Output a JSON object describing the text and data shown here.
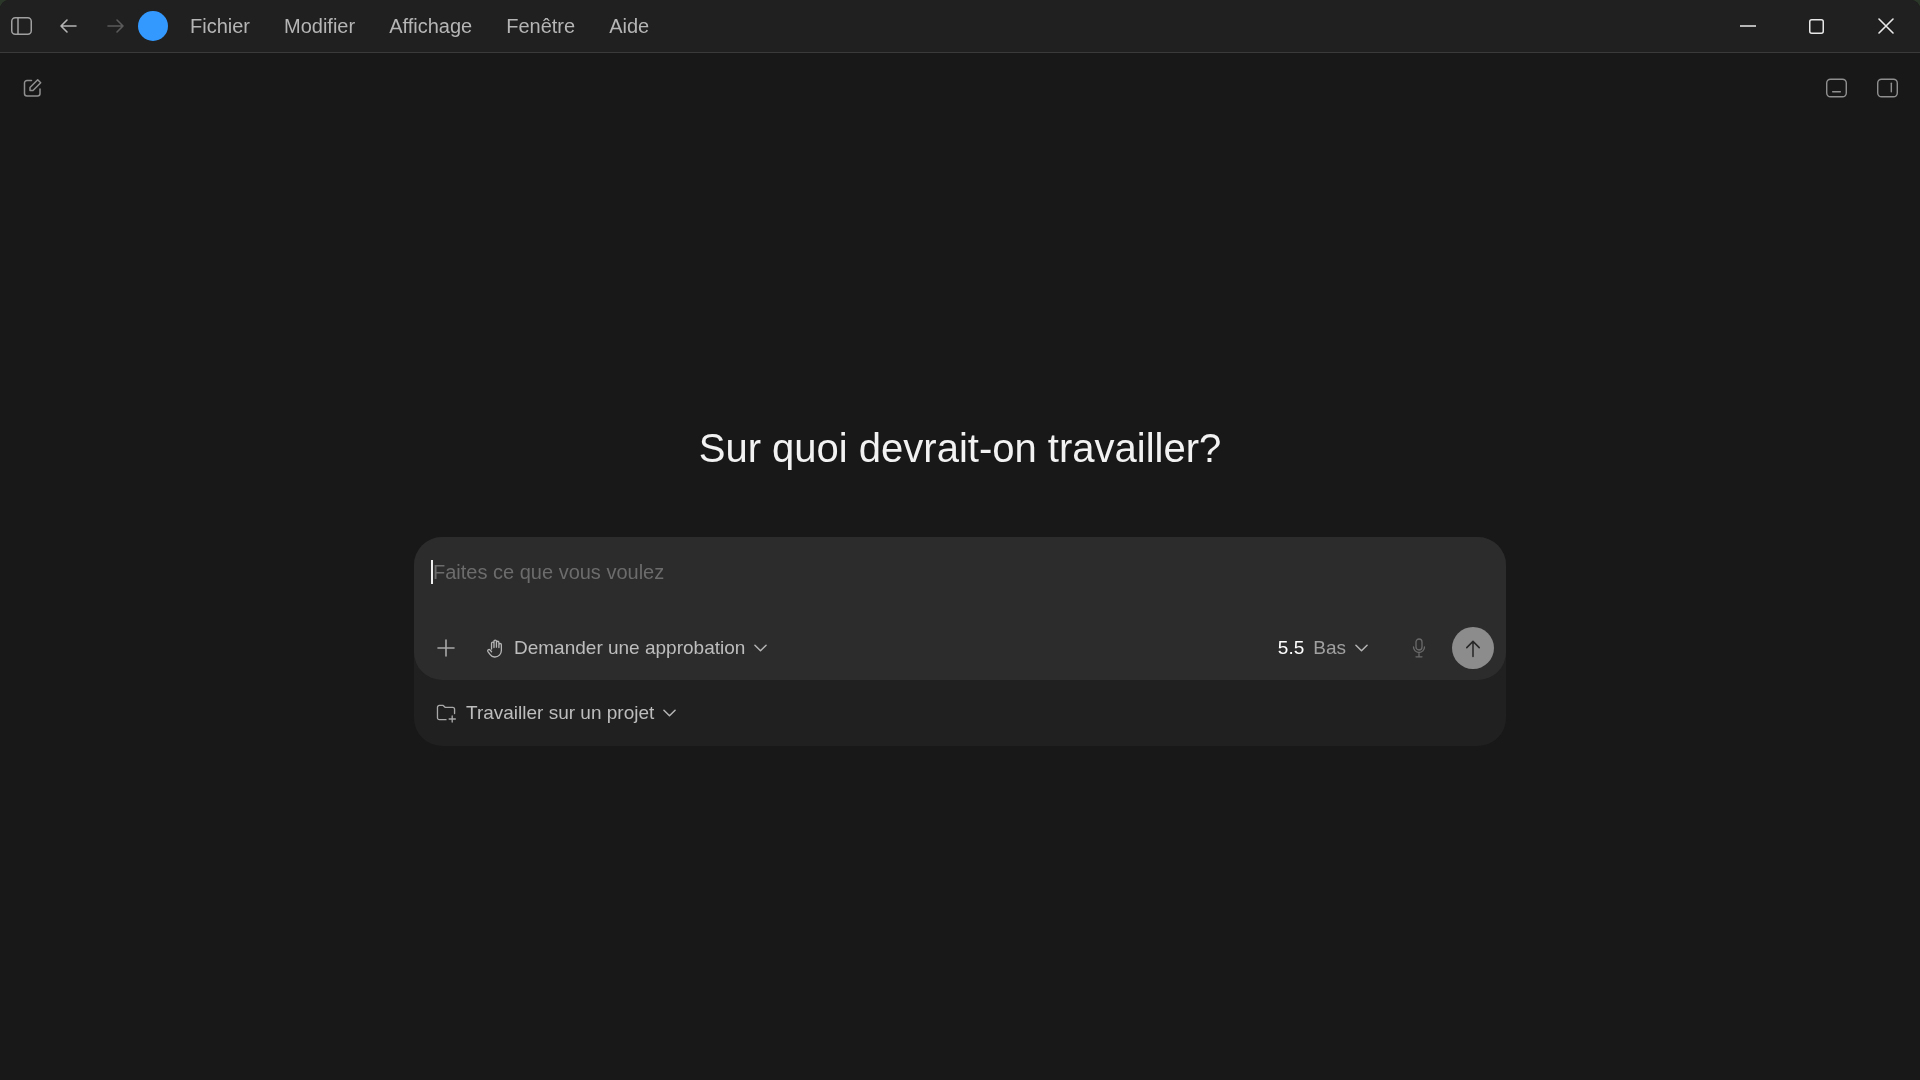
{
  "title_bar": {
    "nav": [
      {
        "kind": "back",
        "disabled": false
      },
      {
        "kind": "forward",
        "disabled": true
      }
    ],
    "menus": [
      "Fichier",
      "Modifier",
      "Affichage",
      "Fenêtre",
      "Aide"
    ]
  },
  "heading": "Sur quoi devrait-on travailler?",
  "composer": {
    "placeholder": "Faites ce que vous voulez",
    "approval_mode": "Demander une approbation",
    "model": "5.5",
    "reasoning": "Bas"
  },
  "project_picker": "Travailler sur un projet"
}
